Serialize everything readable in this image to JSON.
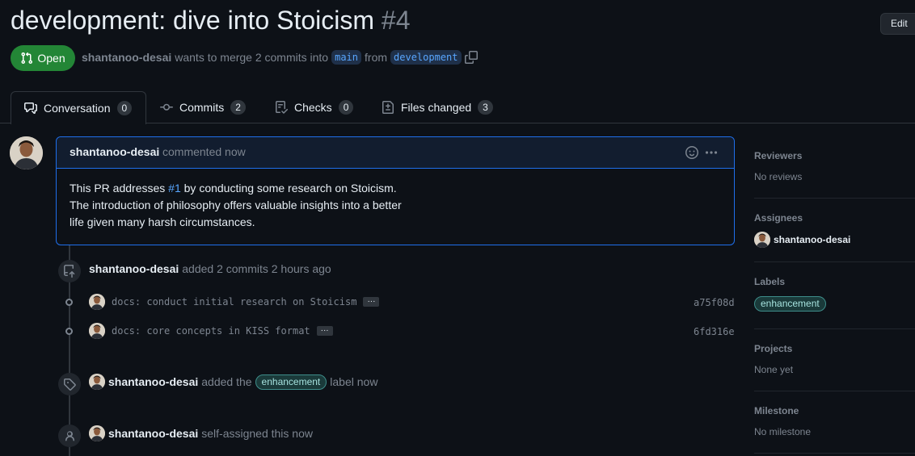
{
  "header": {
    "title": "development: dive into Stoicism",
    "number": "#4",
    "edit_label": "Edit",
    "state_label": "Open",
    "author": "shantanoo-desai",
    "merge_text": "wants to merge 2 commits into",
    "base_branch": "main",
    "from_text": "from",
    "head_branch": "development"
  },
  "tabs": [
    {
      "label": "Conversation",
      "count": "0"
    },
    {
      "label": "Commits",
      "count": "2"
    },
    {
      "label": "Checks",
      "count": "0"
    },
    {
      "label": "Files changed",
      "count": "3"
    }
  ],
  "comment": {
    "author": "shantanoo-desai",
    "time": "commented now",
    "line1_pre": "This PR addresses ",
    "line1_link": "#1",
    "line1_post": " by conducting some research on Stoicism.",
    "line2": "The introduction of philosophy offers valuable insights into a better",
    "line3": "life given many harsh circumstances."
  },
  "timeline": {
    "commits_event": {
      "author": "shantanoo-desai",
      "text": "added 2 commits 2 hours ago"
    },
    "commits": [
      {
        "message": "docs: conduct initial research on Stoicism",
        "sha": "a75f08d",
        "more": "···"
      },
      {
        "message": "docs: core concepts in KISS format",
        "sha": "6fd316e",
        "more": "···"
      }
    ],
    "label_event": {
      "author": "shantanoo-desai",
      "pre": "added the",
      "label": "enhancement",
      "post": "label now"
    },
    "assign_event": {
      "author": "shantanoo-desai",
      "text": "self-assigned this now"
    }
  },
  "sidebar": {
    "reviewers": {
      "heading": "Reviewers",
      "value": "No reviews"
    },
    "assignees": {
      "heading": "Assignees",
      "value": "shantanoo-desai"
    },
    "labels": {
      "heading": "Labels",
      "value": "enhancement"
    },
    "projects": {
      "heading": "Projects",
      "value": "None yet"
    },
    "milestone": {
      "heading": "Milestone",
      "value": "No milestone"
    }
  },
  "colors": {
    "accent": "#1f6feb",
    "open": "#238636",
    "link": "#58a6ff",
    "background": "#0d1117"
  },
  "icons": [
    "git-pull-request-icon",
    "copy-icon",
    "comment-discussion-icon",
    "git-commit-icon",
    "checklist-icon",
    "file-diff-icon",
    "smiley-icon",
    "kebab-horizontal-icon",
    "repo-push-icon",
    "tag-icon",
    "person-icon"
  ]
}
